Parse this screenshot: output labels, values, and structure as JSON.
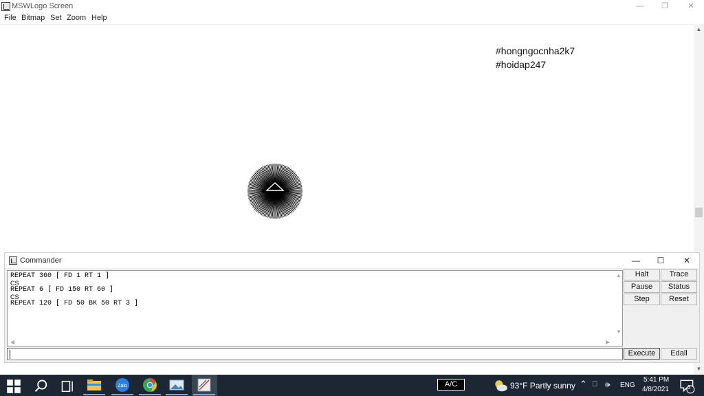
{
  "window": {
    "title": "MSWLogo Screen",
    "minimize": "—",
    "restore": "❐",
    "close": "✕"
  },
  "menu": [
    "File",
    "Bitmap",
    "Set",
    "Zoom",
    "Help"
  ],
  "canvas": {
    "notes": [
      "#hongngocnha2k7",
      "#hoidap247"
    ]
  },
  "commander": {
    "title": "Commander",
    "minimize": "—",
    "maximize": "☐",
    "close": "✕",
    "history": [
      "REPEAT 360 [ FD 1 RT 1 ]",
      "CS",
      "REPEAT 6 [ FD 150 RT 60 ]",
      "CS",
      "REPEAT 120 [ FD 50 BK 50 RT 3 ]"
    ],
    "input_value": "",
    "buttons": {
      "halt": "Halt",
      "trace": "Trace",
      "pause": "Pause",
      "status": "Status",
      "step": "Step",
      "reset": "Reset",
      "execute": "Execute",
      "edall": "Edall"
    }
  },
  "taskbar": {
    "ac_badge": "A/C",
    "weather": "93°F  Partly sunny",
    "language": "ENG",
    "time": "5:41 PM",
    "date": "4/8/2021",
    "notification_count": "3",
    "zalo_label": "Zalo"
  },
  "drawing": {
    "ray_count": 120,
    "ray_length": 50,
    "angle_step": 3,
    "color": "#000000"
  }
}
